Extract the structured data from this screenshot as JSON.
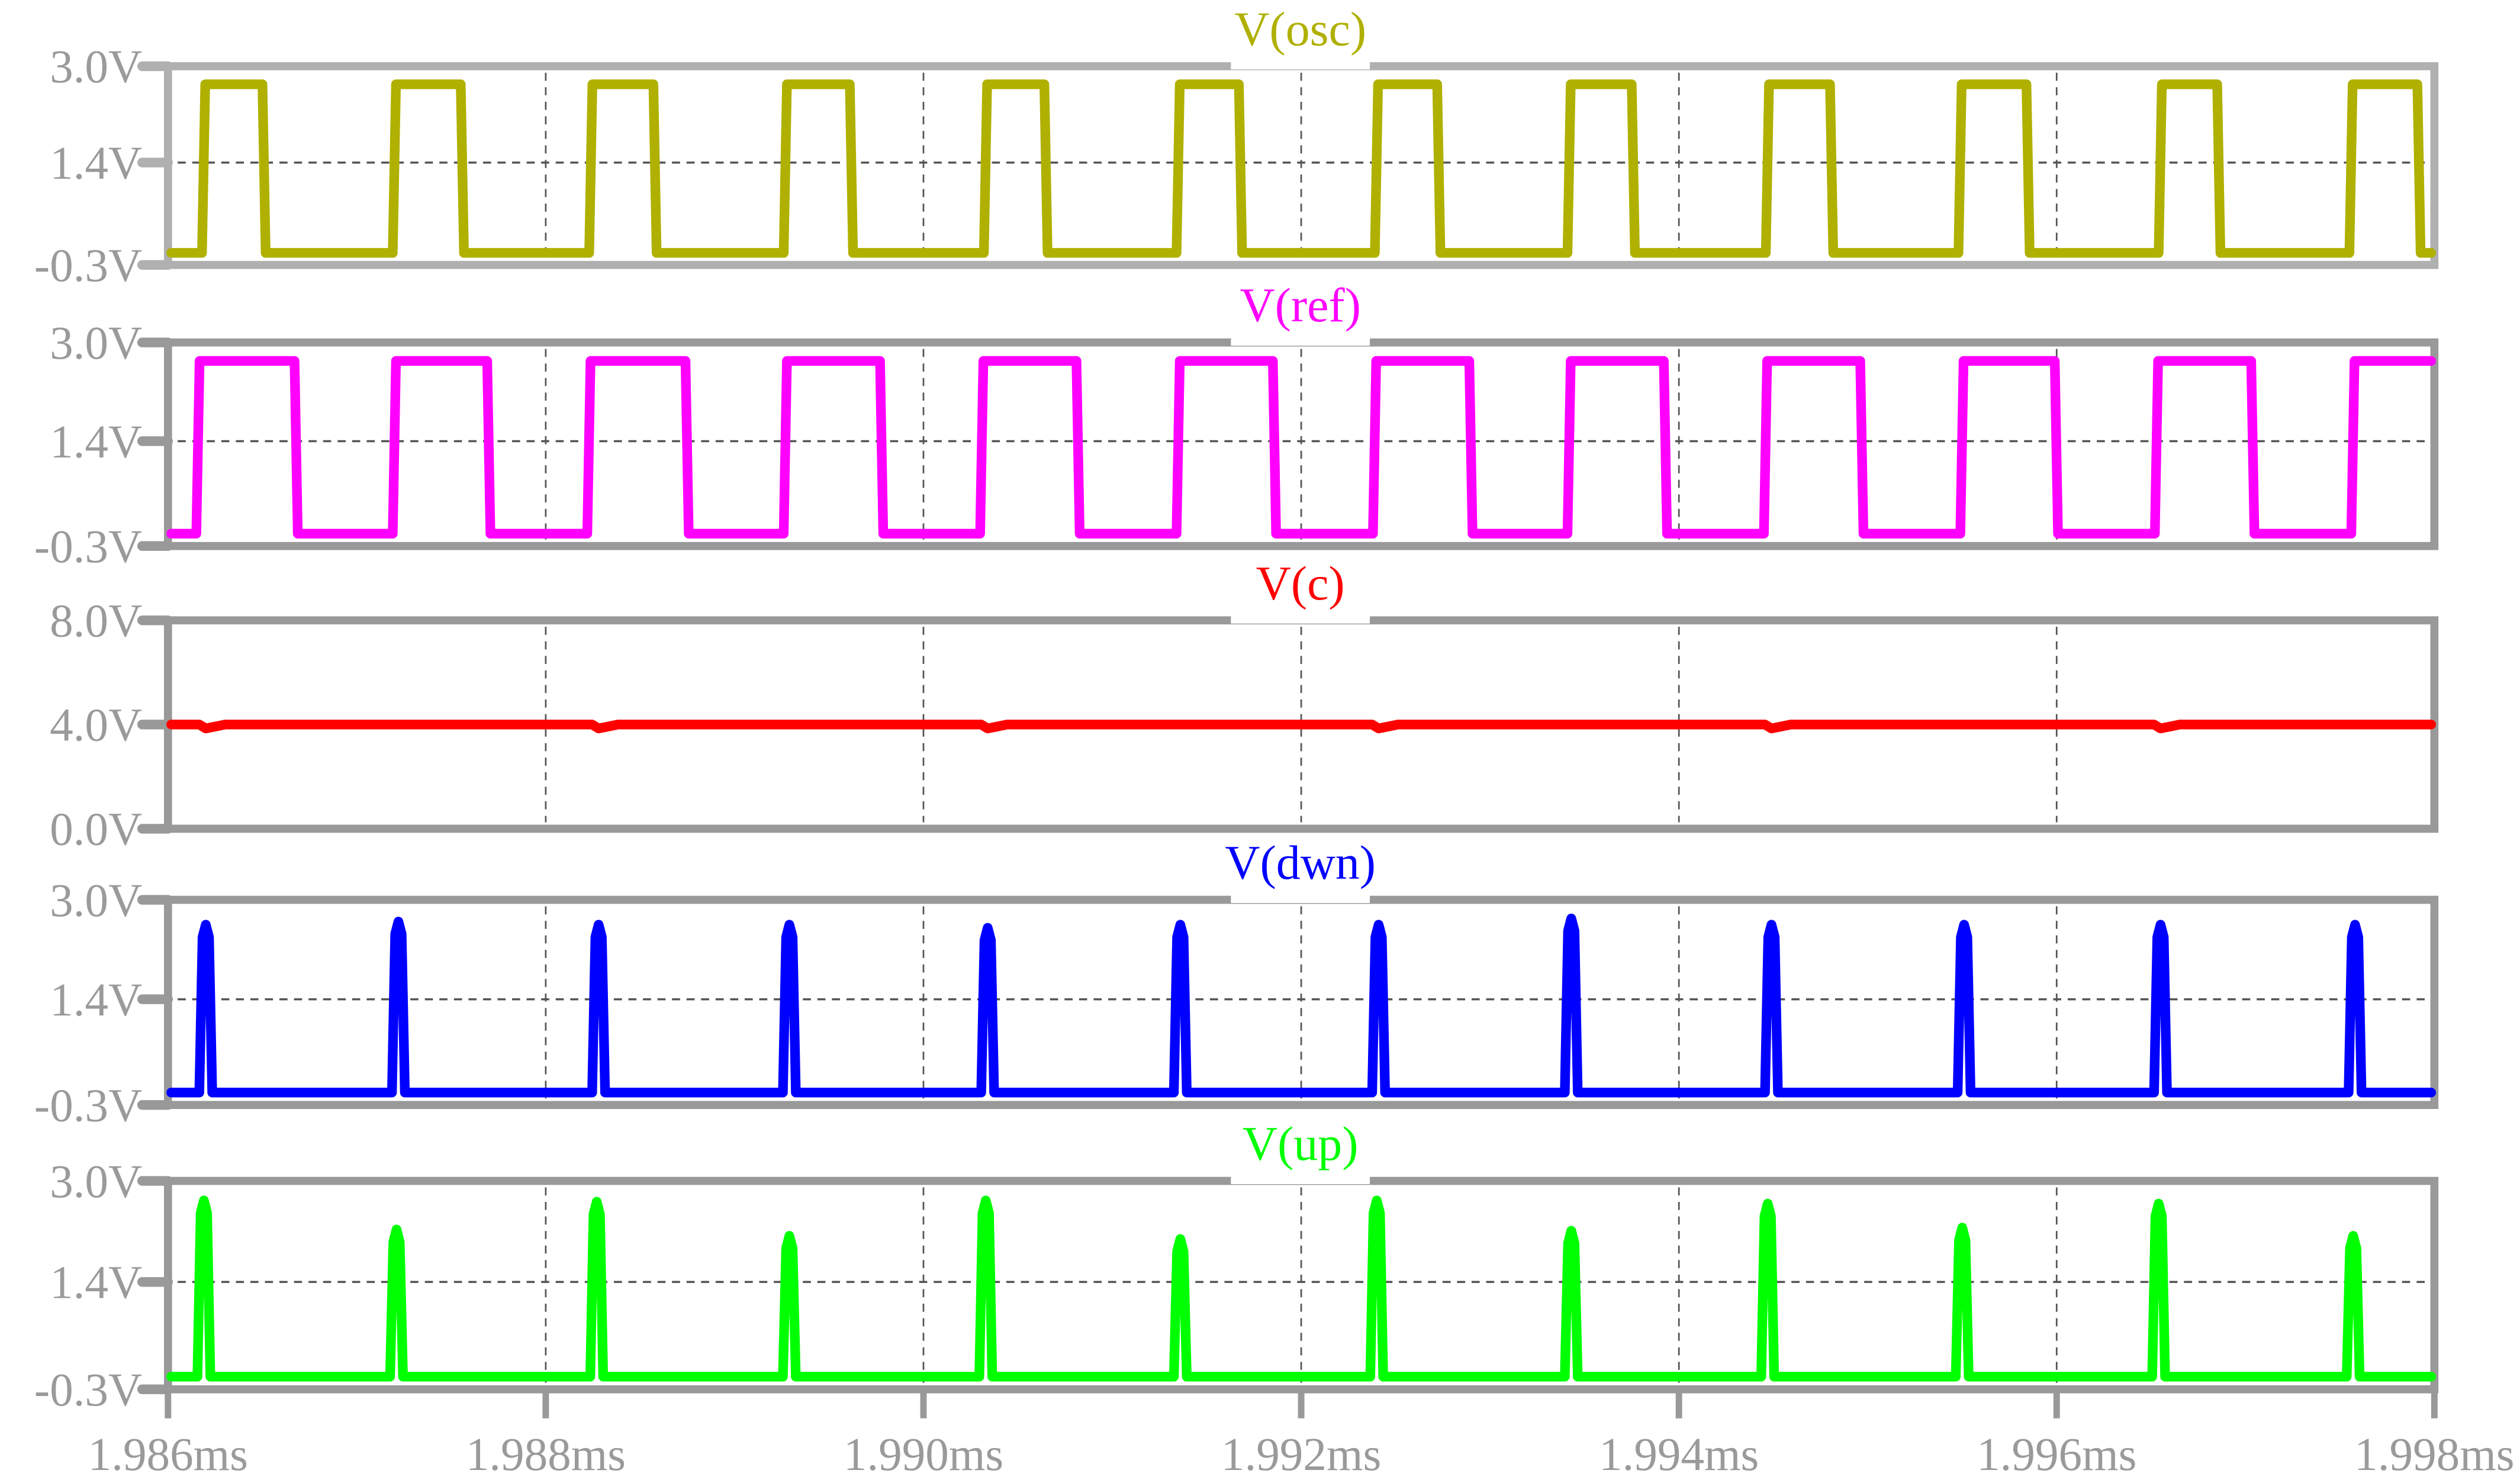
{
  "chart_data": {
    "type": "line",
    "x_range": [
      1.986,
      1.998
    ],
    "x_unit": "ms",
    "x_ticks": [
      "1.986ms",
      "1.988ms",
      "1.990ms",
      "1.992ms",
      "1.994ms",
      "1.996ms",
      "1.998ms"
    ],
    "x_tick_values": [
      1.986,
      1.988,
      1.99,
      1.992,
      1.994,
      1.996,
      1.998
    ],
    "grid": true,
    "panels": [
      {
        "title": "V(osc)",
        "color": "#b0b000",
        "axis_color": "#b0b0b0",
        "ylim": [
          -0.3,
          3.0
        ],
        "y_ticks": [
          "3.0V",
          "1.4V",
          "-0.3V"
        ],
        "y_tick_values": [
          3.0,
          1.4,
          -0.3
        ],
        "kind": "square",
        "low": -0.1,
        "high": 2.7,
        "start_level": "low",
        "rising": [
          1.98618,
          1.98719,
          1.98823,
          1.98926,
          1.99032,
          1.99134,
          1.99239,
          1.99341,
          1.99446,
          1.99548,
          1.99654,
          1.99755
        ],
        "falling": [
          1.9865,
          1.98755,
          1.98857,
          1.98961,
          1.99064,
          1.99167,
          1.99272,
          1.99375,
          1.9948,
          1.99584,
          1.99685,
          1.99791
        ]
      },
      {
        "title": "V(ref)",
        "color": "#ff00ff",
        "axis_color": "#999999",
        "ylim": [
          -0.3,
          3.0
        ],
        "y_ticks": [
          "3.0V",
          "1.4V",
          "-0.3V"
        ],
        "y_tick_values": [
          3.0,
          1.4,
          -0.3
        ],
        "kind": "square",
        "low": -0.1,
        "high": 2.7,
        "start_level": "low",
        "rising": [
          1.98615,
          1.98719,
          1.98822,
          1.98926,
          1.9903,
          1.99134,
          1.99238,
          1.99341,
          1.99445,
          1.99549,
          1.99652,
          1.99756
        ],
        "falling": [
          1.98667,
          1.98769,
          1.98874,
          1.98977,
          1.99081,
          1.99185,
          1.99289,
          1.99392,
          1.99496,
          1.99599,
          1.99703
        ]
      },
      {
        "title": "V(c)",
        "color": "#ff0000",
        "axis_color": "#999999",
        "ylim": [
          0.0,
          8.0
        ],
        "y_ticks": [
          "8.0V",
          "4.0V",
          "0.0V"
        ],
        "y_tick_values": [
          8.0,
          4.0,
          0.0
        ],
        "kind": "flat",
        "level": 4.0,
        "dips": [
          1.9862,
          1.98828,
          1.99034,
          1.99241,
          1.99449,
          1.99655
        ],
        "dip_level": 3.85
      },
      {
        "title": "V(dwn)",
        "color": "#0000ff",
        "axis_color": "#999999",
        "ylim": [
          -0.3,
          3.0
        ],
        "y_ticks": [
          "3.0V",
          "1.4V",
          "-0.3V"
        ],
        "y_tick_values": [
          3.0,
          1.4,
          -0.3
        ],
        "kind": "pulses",
        "low": -0.1,
        "pulse_times": [
          1.9862,
          1.98722,
          1.98828,
          1.98929,
          1.99034,
          1.99136,
          1.99241,
          1.99343,
          1.99449,
          1.99551,
          1.99655,
          1.99758
        ],
        "pulse_peaks": [
          2.6,
          2.65,
          2.6,
          2.6,
          2.55,
          2.6,
          2.6,
          2.7,
          2.6,
          2.6,
          2.6,
          2.6
        ]
      },
      {
        "title": "V(up)",
        "color": "#00ff00",
        "axis_color": "#999999",
        "ylim": [
          -0.3,
          3.0
        ],
        "y_ticks": [
          "3.0V",
          "1.4V",
          "-0.3V"
        ],
        "y_tick_values": [
          3.0,
          1.4,
          -0.3
        ],
        "kind": "pulses",
        "low": -0.1,
        "pulse_times": [
          1.98619,
          1.98721,
          1.98827,
          1.98929,
          1.99033,
          1.99136,
          1.9924,
          1.99343,
          1.99447,
          1.9955,
          1.99654,
          1.99757
        ],
        "pulse_peaks": [
          2.69,
          2.23,
          2.67,
          2.13,
          2.69,
          2.08,
          2.69,
          2.21,
          2.64,
          2.26,
          2.64,
          2.13
        ]
      }
    ]
  }
}
